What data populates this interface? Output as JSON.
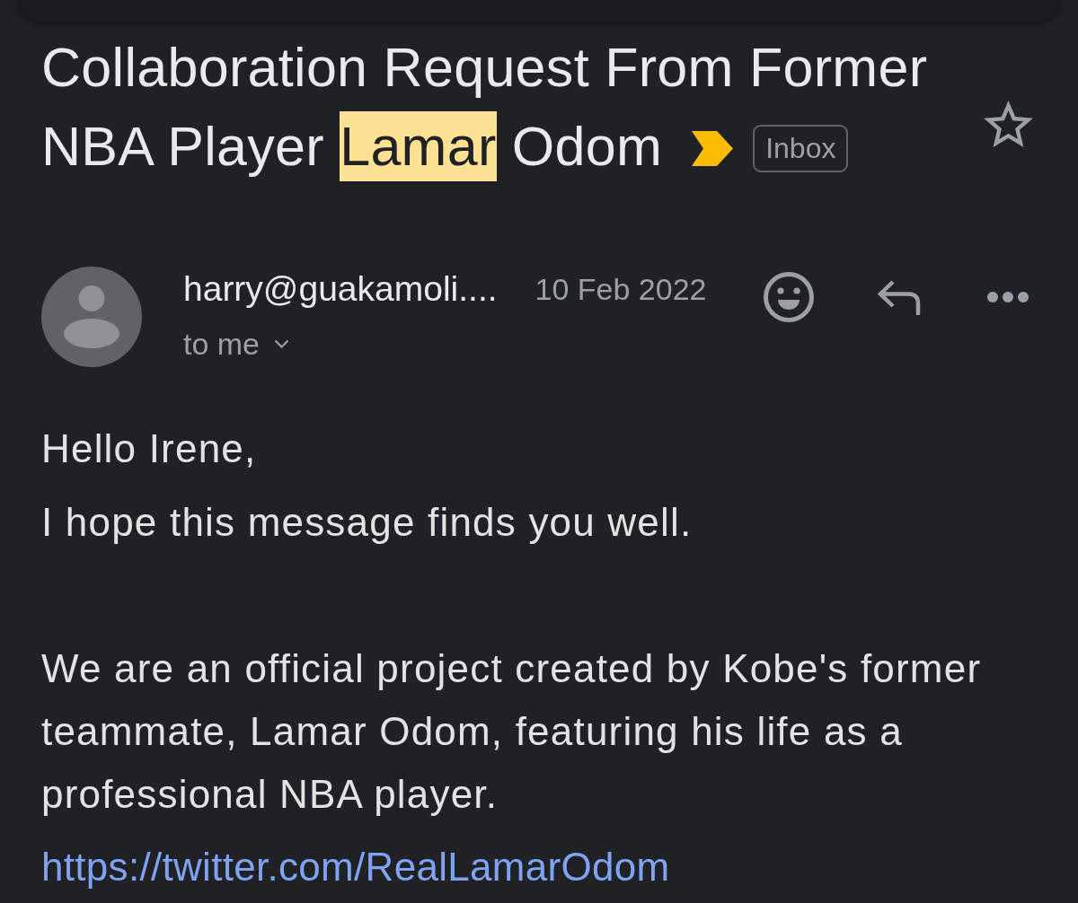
{
  "subject": {
    "segments": [
      {
        "text": "Collaboration Request From Former NBA Player ",
        "highlighted": false
      },
      {
        "text": "Lamar",
        "highlighted": true
      },
      {
        "text": " Odom",
        "highlighted": false
      }
    ],
    "important": true,
    "label": "Inbox",
    "starred": false
  },
  "message": {
    "sender": "harry@guakamoli....",
    "date": "10 Feb 2022",
    "recipient": "to me"
  },
  "body": [
    {
      "paragraphs": [
        {
          "kind": "text",
          "text": "Hello Irene,"
        },
        {
          "kind": "text",
          "text": "I hope this message finds you well."
        }
      ]
    },
    {
      "paragraphs": [
        {
          "kind": "text",
          "text": "We are an official project created by Kobe's former teammate, Lamar Odom, featuring his life as a professional NBA player."
        },
        {
          "kind": "link",
          "text": "https://twitter.com/RealLamarOdom"
        }
      ]
    }
  ]
}
